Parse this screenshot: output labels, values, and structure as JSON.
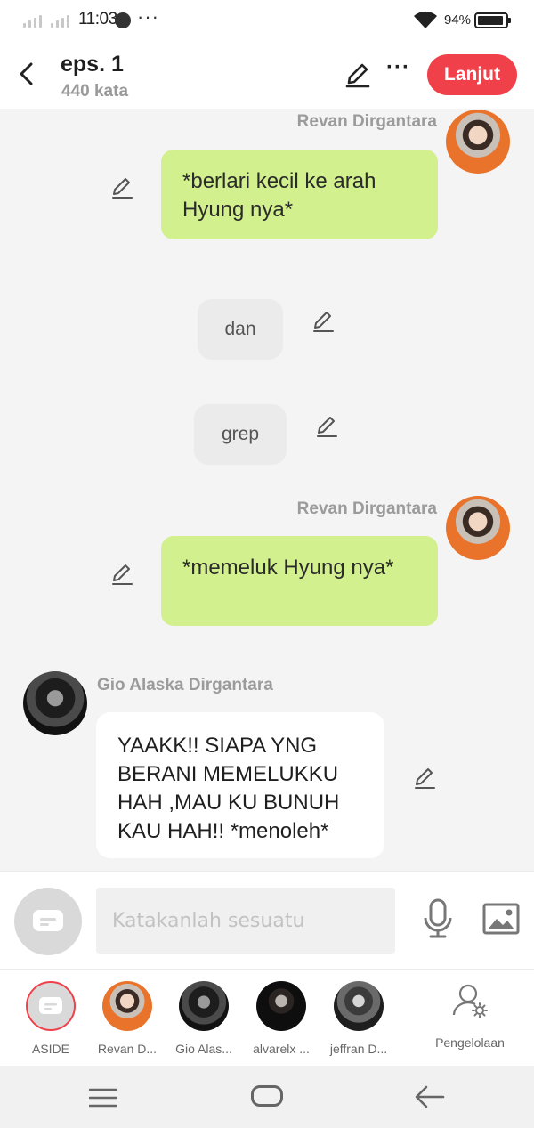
{
  "status_bar": {
    "time": "11:03",
    "more": "···",
    "battery_text": "94%",
    "battery_level": 0.94
  },
  "header": {
    "title": "eps. 1",
    "subtitle": "440 kata",
    "more": "···",
    "next_label": "Lanjut",
    "accent_color": "#f0414b"
  },
  "messages": [
    {
      "type": "right",
      "sender": "Revan Dirgantara",
      "text": "*berlari kecil ke arah Hyung nya*"
    },
    {
      "type": "narration",
      "text": "dan"
    },
    {
      "type": "narration",
      "text": "grep"
    },
    {
      "type": "right",
      "sender": "Revan Dirgantara",
      "text": "*memeluk Hyung nya*"
    },
    {
      "type": "left",
      "sender": "Gio Alaska Dirgantara",
      "text": "YAAKK!! SIAPA YNG BERANI MEMELUKKU HAH ,MAU KU BUNUH KAU HAH!! *menoleh*"
    }
  ],
  "input": {
    "placeholder": "Katakanlah sesuatu",
    "value": ""
  },
  "characters": [
    {
      "label": "ASIDE",
      "avatar": "aside-icon"
    },
    {
      "label": "Revan D...",
      "avatar": "orange"
    },
    {
      "label": "Gio Alas...",
      "avatar": "dark"
    },
    {
      "label": "alvarelx ...",
      "avatar": "black"
    },
    {
      "label": "jeffran D...",
      "avatar": "gray"
    }
  ],
  "management_label": "Pengelolaan",
  "colors": {
    "bubble_green": "#d2f08d",
    "background": "#f4f4f4"
  }
}
